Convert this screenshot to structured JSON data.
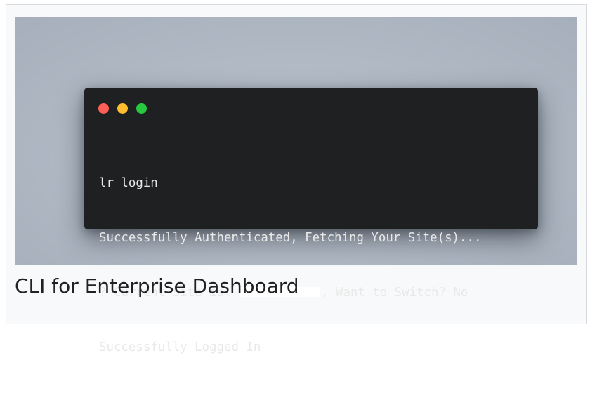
{
  "terminal": {
    "window_controls": [
      {
        "name": "close",
        "color": "#ff5f57"
      },
      {
        "name": "minimize",
        "color": "#febc2e"
      },
      {
        "name": "maximize",
        "color": "#28c840"
      }
    ],
    "lines": {
      "command": "lr login",
      "auth": "Successfully Authenticated, Fetching Your Site(s)...",
      "site_prefix": "? Current Site is: ",
      "site_suffix": ", Want to Switch? No",
      "result": "Successfully Logged In"
    }
  },
  "caption": "CLI for Enterprise Dashboard"
}
